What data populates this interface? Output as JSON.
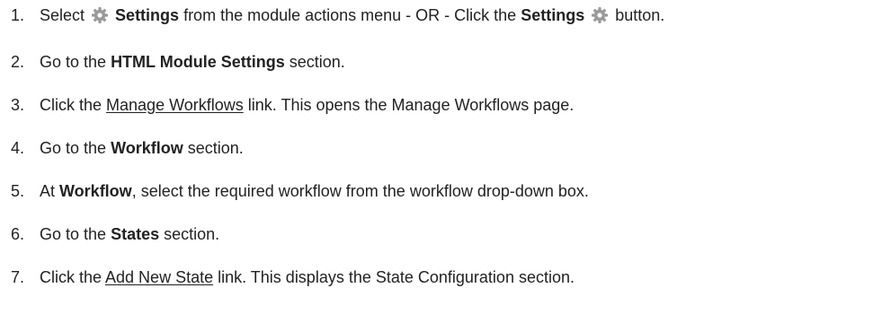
{
  "steps": [
    {
      "num": "1.",
      "t1": "Select ",
      "settings_bold_1": "Settings",
      "t2": " from the module actions menu - OR - Click the ",
      "settings_bold_2": "Settings",
      "t3": " button."
    },
    {
      "num": "2.",
      "t1": "Go to the ",
      "bold": "HTML Module Settings",
      "t2": " section."
    },
    {
      "num": "3.",
      "t1": "Click the ",
      "link": "Manage Workflows",
      "t2": " link. This opens the Manage Workflows page."
    },
    {
      "num": "4.",
      "t1": "Go to the ",
      "bold": "Workflow",
      "t2": " section."
    },
    {
      "num": "5.",
      "t1": "At ",
      "bold": "Workflow",
      "t2": ", select the required workflow from the workflow drop-down box."
    },
    {
      "num": "6.",
      "t1": "Go to the ",
      "bold": "States",
      "t2": " section."
    },
    {
      "num": "7.",
      "t1": "Click the ",
      "link": "Add New State",
      "t2": " link. This displays the State Configuration section."
    }
  ],
  "icons": {
    "settings": "gear-icon"
  },
  "colors": {
    "text": "#222222",
    "gear": "#9a9a9a"
  }
}
